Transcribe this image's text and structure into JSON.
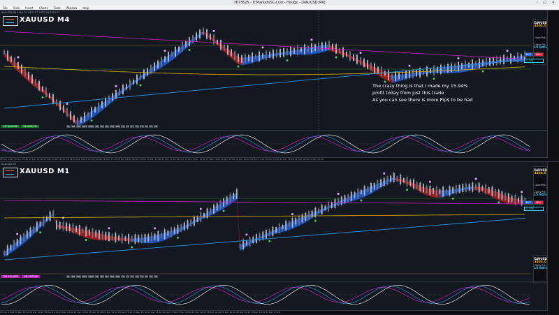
{
  "window": {
    "title": "7673625 - ICMarketsSC-Live - Hedge - [XAUUSD,M4]",
    "menu": [
      "File",
      "View",
      "Insert",
      "Charts",
      "Tools",
      "Window",
      "Help"
    ]
  },
  "top_chart": {
    "subtitle": "XAUUSD,M4  4404.34 4404.87 4403.96 4404.21",
    "symbol": "XAUUSD M4",
    "info": {
      "symbol": "XAUUSD",
      "price": "4404.0",
      "open_label": "OpenPos",
      "percent_label": "Daily Pct",
      "percent": "15.94%"
    },
    "buttons": {
      "buy": "BUY",
      "sell": "SELL",
      "close": "CLOSE"
    },
    "tags": [
      "UP SQUARE",
      "UP ARROW"
    ],
    "datebar": [
      "S1",
      "M1",
      "M5",
      "M15",
      "M30",
      "H1",
      "H4",
      "D1",
      "W1",
      "MN",
      "T1",
      "T2",
      "T3",
      "T4",
      "T5",
      "T6",
      "T7",
      "T8"
    ],
    "annotation": [
      "The crazy thing is that I made my 15.94%",
      "profit today from just this trade",
      "As you can see there is more Pip$ to be had"
    ],
    "time_labels": "25 Dec 2025  25 Dec 01:00  25 Dec 02:00  25 Dec 03:00  25 Dec 04:00  25 Dec 05:00  25 Dec 06:00  25 Dec 07:00  25 Dec 08:00  25 Dec 09:00  25 Dec 10:00  25 Dec 11:00  25 Dec 12:00  25 Dec 13:00  25 Dec 14:00  25 Dec 15:00  25 Dec 16:00  25 Dec 17:00  25 Dec 18:00  25 Dec 19:00  25 Dec 20:00  25 Dec 21:00"
  },
  "bottom_chart": {
    "subtitle": "XAUUSD,M1",
    "symbol": "XAUUSD M1",
    "info": {
      "symbol": "XAUUSD",
      "price": "4404.0",
      "open_label": "OpenPos",
      "percent_label": "Daily Pct",
      "percent": "15.94%"
    },
    "buttons": {
      "buy": "BUY",
      "sell": "SELL",
      "close": "CLOSE"
    },
    "tags": [
      "DN SQUARE",
      "DN ARROW"
    ],
    "datebar": [
      "S1",
      "M1",
      "M5",
      "M15",
      "M30",
      "H1",
      "H4",
      "D1",
      "W1",
      "MN",
      "T1",
      "T2",
      "T3",
      "T4",
      "T5",
      "T6",
      "T7",
      "T8"
    ],
    "time_labels": "25 Dec 14:00  25 Dec 14:10  25 Dec 14:20  25 Dec 14:30  25 Dec 14:40  25 Dec 14:50  25 Dec 15:00  25 Dec 15:10  25 Dec 15:20  25 Dec 15:30  25 Dec 15:40  25 Dec 15:50  25 Dec 16:00  25 Dec 16:10  25 Dec 16:20  25 Dec 16:30  25 Dec 16:40  25 Dec 16:50  25 Dec 17:00"
  },
  "colors": {
    "bull": "#1e5ad6",
    "bear": "#b31a1a",
    "ma_yellow": "#d9b300",
    "ma_blue": "#2a8bd6",
    "ma_magenta": "#c21fc4",
    "osc_white": "#e6e6e6",
    "osc_blue": "#2a8bd6",
    "osc_magenta": "#c21fc4",
    "candle_up": "#aab1bd",
    "candle_dn": "#6b7280"
  }
}
